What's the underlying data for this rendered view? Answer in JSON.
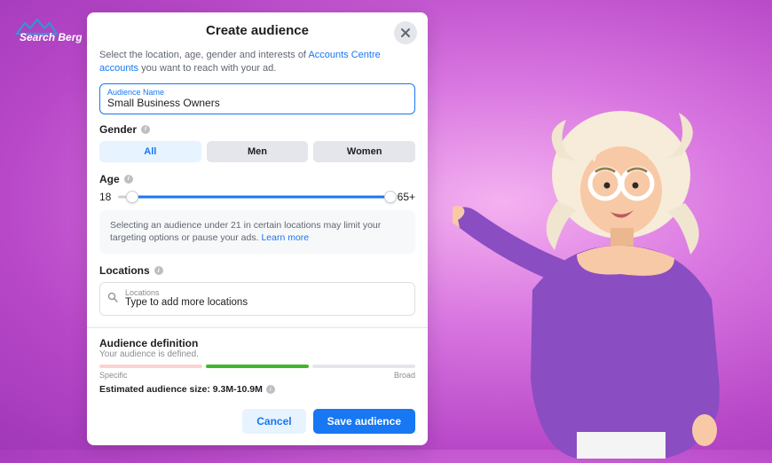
{
  "logo": {
    "text": "Search Berg"
  },
  "dialog": {
    "title": "Create audience",
    "intro_pre": "Select the location, age, gender and interests of ",
    "intro_link": "Accounts Centre accounts",
    "intro_post": " you want to reach with your ad.",
    "audience_name": {
      "label": "Audience Name",
      "value": "Small Business Owners"
    },
    "gender": {
      "label": "Gender",
      "options": [
        "All",
        "Men",
        "Women"
      ],
      "selected": "All"
    },
    "age": {
      "label": "Age",
      "min": "18",
      "max": "65+",
      "note_pre": "Selecting an audience under 21 in certain locations may limit your targeting options or pause your ads. ",
      "note_link": "Learn more"
    },
    "locations": {
      "label": "Locations",
      "field_label": "Locations",
      "placeholder": "Type to add more locations"
    },
    "definition": {
      "title": "Audience definition",
      "subtitle": "Your audience is defined.",
      "specific": "Specific",
      "broad": "Broad",
      "estimate_label": "Estimated audience size: ",
      "estimate_value": "9.3M-10.9M",
      "meter_colors": [
        "#fbd2d2",
        "#42b72a",
        "#e4e6eb"
      ]
    },
    "buttons": {
      "cancel": "Cancel",
      "save": "Save audience"
    }
  }
}
